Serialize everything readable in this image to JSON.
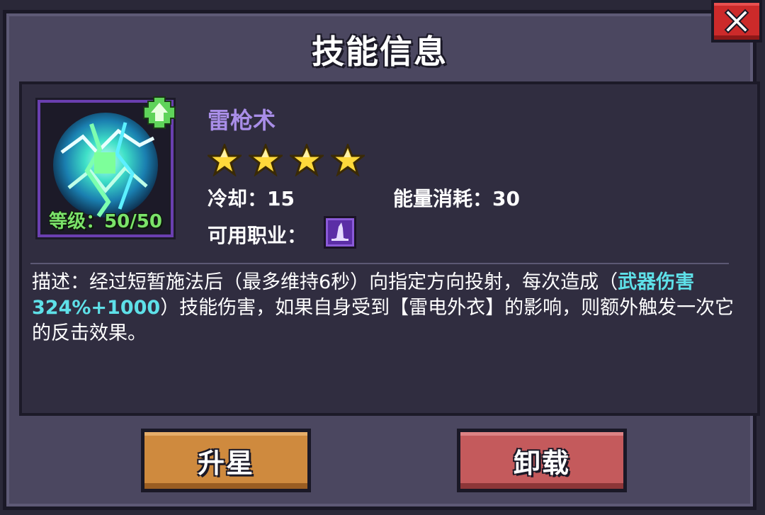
{
  "dialog": {
    "title": "技能信息"
  },
  "skill": {
    "name": "雷枪术",
    "stars": 4,
    "level_text": "等级：50/50",
    "icon": "lightning-orb-icon",
    "cooldown_text": "冷却：15",
    "energy_text": "能量消耗：30",
    "classes_label": "可用职业：",
    "class_icon": "wizard-hat-icon"
  },
  "description": {
    "prefix": "描述：经过短暂施法后（最多维持6秒）向指定方向投射，每次造成（",
    "highlight": "武器伤害324%+1000",
    "suffix": "）技能伤害，如果自身受到【雷电外衣】的影响，则额外触发一次它的反击效果。"
  },
  "buttons": {
    "upgrade": "升星",
    "unequip": "卸载"
  },
  "colors": {
    "dialog_bg": "#4b4760",
    "panel_bg": "#302d40",
    "skill_name": "#a98ee8",
    "level_text": "#7be36a",
    "highlight": "#5ee0e8",
    "upgrade_btn": "#cf8a3e",
    "unequip_btn": "#c45a5c",
    "close_btn": "#cc2a2a"
  }
}
